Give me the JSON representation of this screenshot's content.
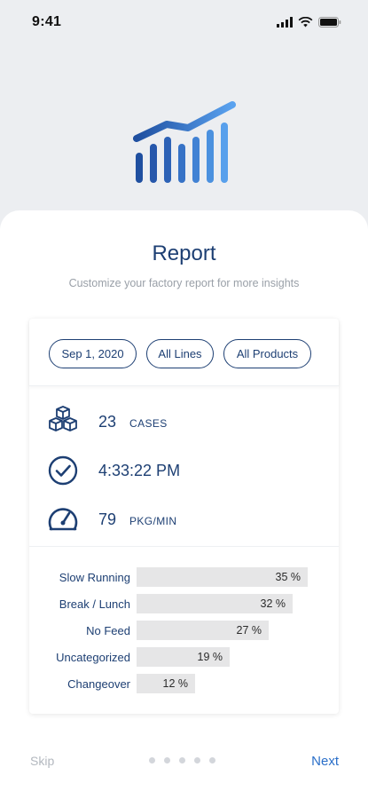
{
  "status_bar": {
    "time": "9:41"
  },
  "header": {
    "title": "Report",
    "subtitle": "Customize your factory report for more insights"
  },
  "filters": {
    "date": "Sep 1, 2020",
    "lines": "All Lines",
    "products": "All Products"
  },
  "stats": [
    {
      "icon": "boxes-icon",
      "value": "23",
      "unit": "CASES"
    },
    {
      "icon": "check-circle-icon",
      "value": "4:33:22 PM",
      "unit": ""
    },
    {
      "icon": "speedometer-icon",
      "value": "79",
      "unit": "PKG/MIN"
    }
  ],
  "downtime": [
    {
      "label": "Slow Running",
      "value": 35,
      "display": "35 %"
    },
    {
      "label": "Break / Lunch",
      "value": 32,
      "display": "32 %"
    },
    {
      "label": "No Feed",
      "value": 27,
      "display": "27 %"
    },
    {
      "label": "Uncategorized",
      "value": 19,
      "display": "19 %"
    },
    {
      "label": "Changeover",
      "value": 12,
      "display": "12 %"
    }
  ],
  "footer": {
    "skip_label": "Skip",
    "next_label": "Next",
    "page_count": 5
  },
  "colors": {
    "primary": "#1d3f73",
    "accent": "#2a6fc9",
    "bar": "#e6e6e7"
  }
}
